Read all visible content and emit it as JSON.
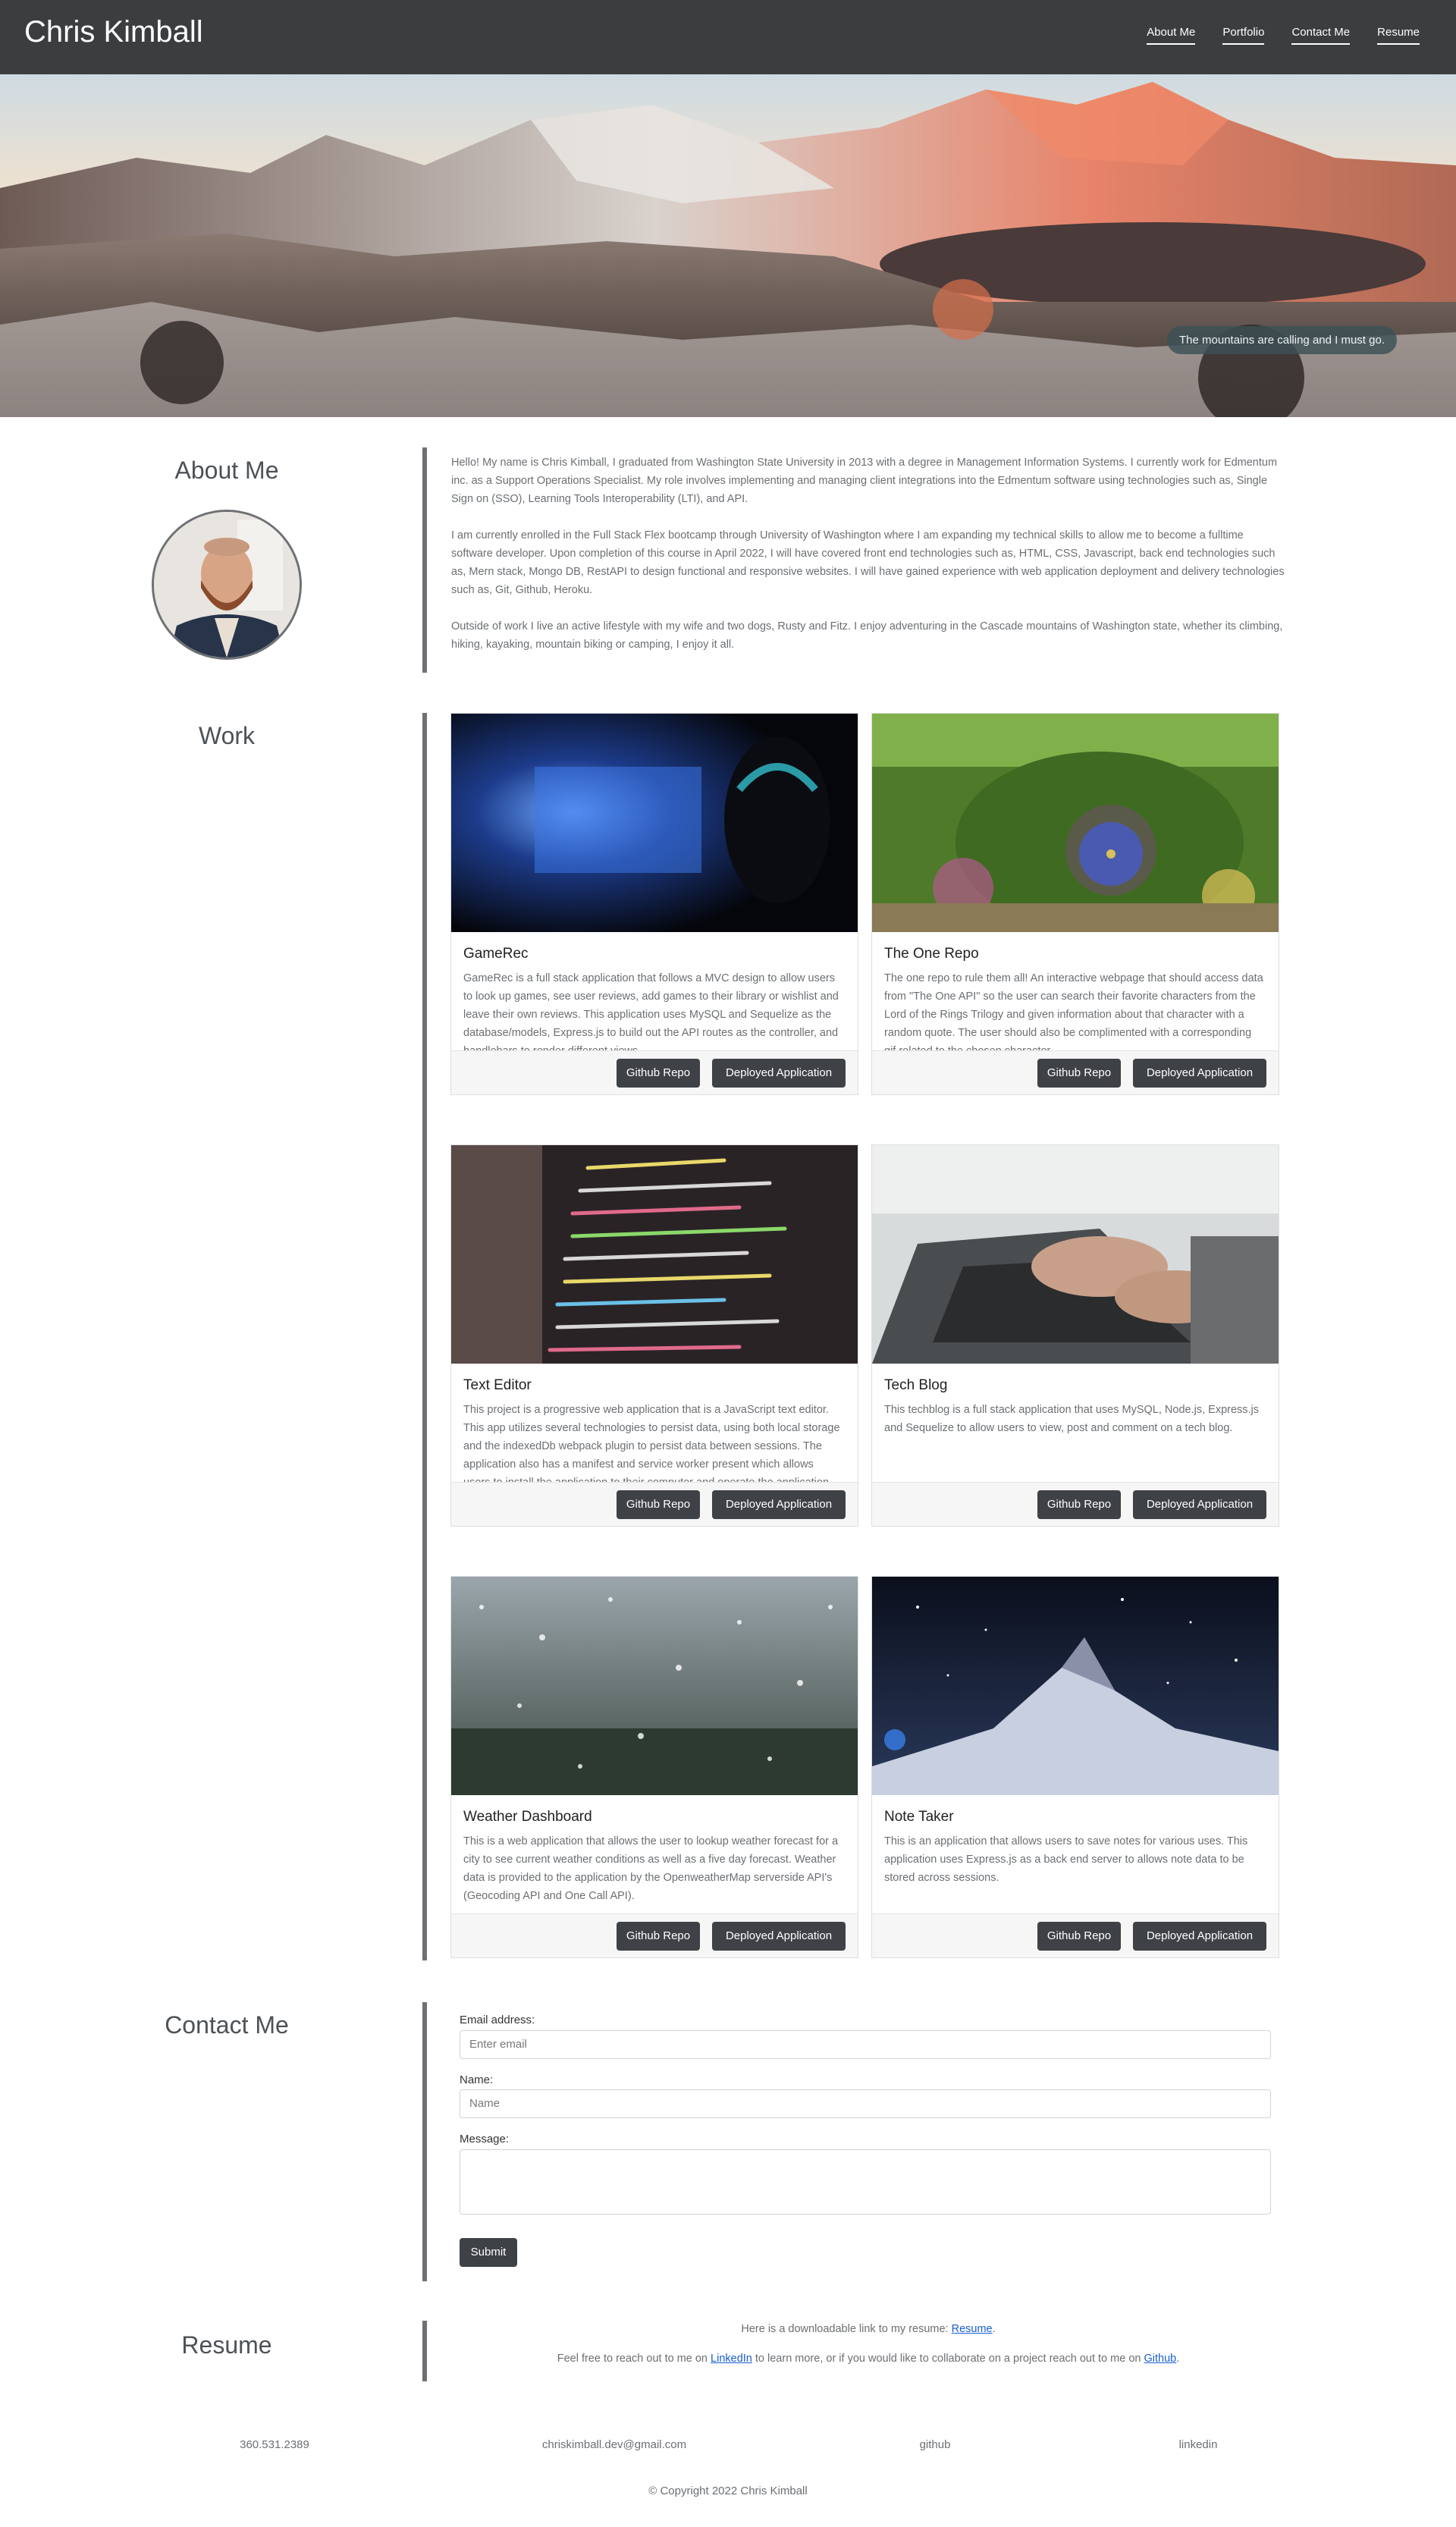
{
  "header": {
    "brand": "Chris Kimball",
    "nav": [
      "About Me",
      "Portfolio",
      "Contact Me",
      "Resume"
    ]
  },
  "hero": {
    "caption": "The mountains are calling and I must go."
  },
  "about": {
    "title": "About Me",
    "paragraphs": [
      "Hello! My name is Chris Kimball, I graduated from Washington State University in 2013 with a degree in Management Information Systems. I currently work for Edmentum inc. as a Support Operations Specialist. My role involves implementing and managing client integrations into the Edmentum software using technologies such as, Single Sign on (SSO), Learning Tools Interoperability (LTI), and API.",
      "I am currently enrolled in the Full Stack Flex bootcamp through University of Washington where I am expanding my technical skills to allow me to become a fulltime software developer. Upon completion of this course in April 2022, I will have covered front end technologies such as, HTML, CSS, Javascript, back end technologies such as, Mern stack, Mongo DB, RestAPI to design functional and responsive websites. I will have gained experience with web application deployment and delivery technologies such as, Git, Github, Heroku.",
      "Outside of work I live an active lifestyle with my wife and two dogs, Rusty and Fitz. I enjoy adventuring in the Cascade mountains of Washington state, whether its climbing, hiking, kayaking, mountain biking or camping, I enjoy it all."
    ]
  },
  "work": {
    "title": "Work",
    "repo_label": "Github Repo",
    "deploy_label": "Deployed Application",
    "projects": [
      {
        "title": "GameRec",
        "description": "GameRec is a full stack application that follows a MVC design to allow users to look up games, see user reviews, add games to their library or wishlist and leave their own reviews. This application uses MySQL and Sequelize as the database/models, Express.js to build out the API routes as the controller, and handlebars to render different views."
      },
      {
        "title": "The One Repo",
        "description": "The one repo to rule them all! An interactive webpage that should access data from \"The One API\" so the user can search their favorite characters from the Lord of the Rings Trilogy and given information about that character with a random quote. The user should also be complimented with a corresponding gif related to the chosen character."
      },
      {
        "title": "Text Editor",
        "description": "This project is a progressive web application that is a JavaScript text editor. This app utilizes several technologies to persist data, using both local storage and the indexedDb webpack plugin to persist data between sessions. The application also has a manifest and service worker present which allows users to install the application to their computer and operate the application without a web browser."
      },
      {
        "title": "Tech Blog",
        "description": "This techblog is a full stack application that uses MySQL, Node.js, Express.js and Sequelize to allow users to view, post and comment on a tech blog."
      },
      {
        "title": "Weather Dashboard",
        "description": "This is a web application that allows the user to lookup weather forecast for a city to see current weather conditions as well as a five day forecast. Weather data is provided to the application by the OpenweatherMap serverside API's (Geocoding API and One Call API)."
      },
      {
        "title": "Note Taker",
        "description": "This is an application that allows users to save notes for various uses. This application uses Express.js as a back end server to allows note data to be stored across sessions."
      }
    ]
  },
  "contact": {
    "title": "Contact Me",
    "email_label": "Email address:",
    "email_placeholder": "Enter email",
    "name_label": "Name:",
    "name_placeholder": "Name",
    "message_label": "Message:",
    "submit_label": "Submit"
  },
  "resume": {
    "title": "Resume",
    "line1_prefix": "Here is a downloadable link to my resume: ",
    "line1_link": "Resume",
    "line1_suffix": ".",
    "line2_prefix": "Feel free to reach out to me on ",
    "line2_link1": "LinkedIn",
    "line2_middle": " to learn more, or if you would like to collaborate on a project reach out to me on ",
    "line2_link2": "Github",
    "line2_suffix": "."
  },
  "footer": {
    "phone": "360.531.2389",
    "email": "chriskimball.dev@gmail.com",
    "github": "github",
    "linkedin": "linkedin",
    "copyright": "© Copyright 2022 Chris Kimball"
  }
}
